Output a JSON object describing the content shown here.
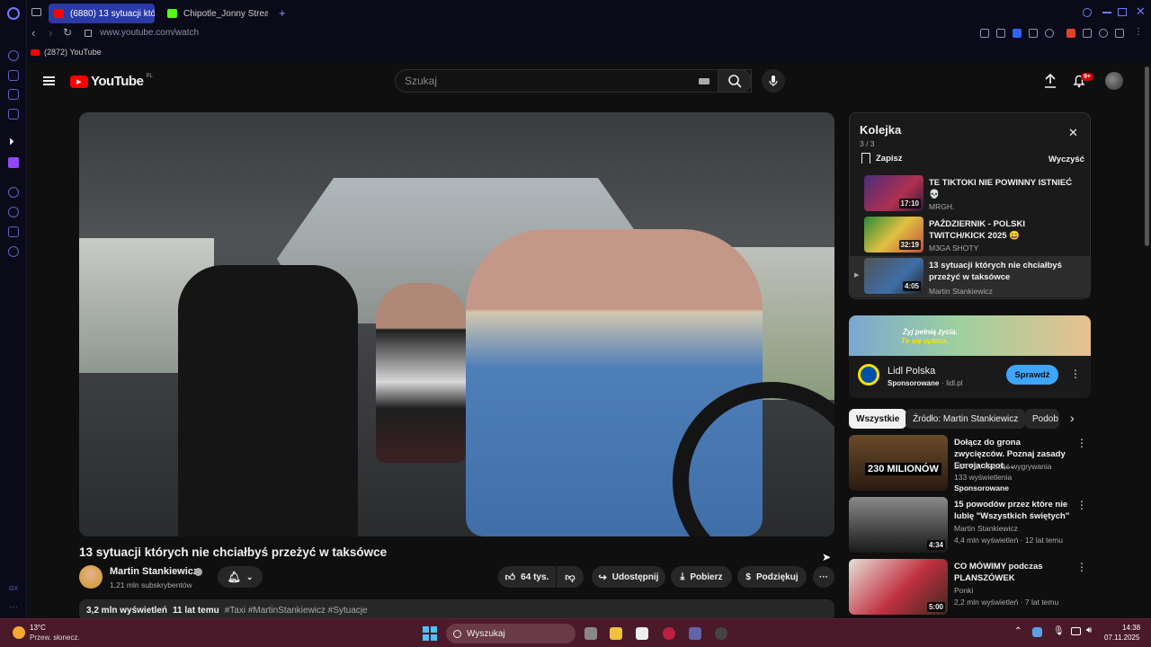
{
  "browser": {
    "tabs": [
      {
        "label": "(6880) 13 sytuacji których",
        "active": true
      },
      {
        "label": "Chipotle_Jonny Stream -",
        "active": false
      }
    ],
    "url": "www.youtube.com/watch",
    "bookmark": "(2872) YouTube",
    "gx_label": "GX"
  },
  "youtube": {
    "logo": "YouTube",
    "logo_region": "PL",
    "search_placeholder": "Szukaj",
    "notif_badge": "9+"
  },
  "video": {
    "title": "13 sytuacji których nie chciałbyś przeżyć w taksówce",
    "channel": "Martin Stankiewicz",
    "subscribers": "1,21 mln subskrybentów",
    "likes": "64 tys.",
    "share": "Udostępnij",
    "download": "Pobierz",
    "thanks": "Podziękuj",
    "views": "3,2 mln wyświetleń",
    "age": "11 lat temu",
    "tags": "#Taxi #MartinStankiewicz #Sytuacje"
  },
  "queue": {
    "title": "Kolejka",
    "count": "3 / 3",
    "save": "Zapisz",
    "clear": "Wyczyść",
    "items": [
      {
        "title": "TE TIKTOKI NIE POWINNY ISTNIEĆ 💀",
        "channel": "MRGH.",
        "duration": "17:10"
      },
      {
        "title": "PAŹDZIERNIK - POLSKI TWITCH/KICK 2025 😄",
        "channel": "M3GA SHOTY",
        "duration": "32:19"
      },
      {
        "title": "13 sytuacji których nie chciałbyś przeżyć w taksówce",
        "channel": "Martin Stankiewicz",
        "duration": "4:05"
      }
    ]
  },
  "ad": {
    "banner_line1": "Żyj pełnią życia.",
    "banner_line2": "To się opłaca.",
    "brand": "Lidl Polska",
    "sponsored": "Sponsorowane",
    "domain": "· lidl.pl",
    "cta": "Sprawdź"
  },
  "chips": [
    "Wszystkie",
    "Źródło: Martin Stankiewicz",
    "Podob"
  ],
  "recommendations": [
    {
      "title": "Dołącz do grona zwycięzców. Poznaj zasady Eurojackpot,...",
      "line1": "LOTTO. Radość wygrywania",
      "line2": "133 wyświetlenia",
      "line3": "Sponsorowane",
      "thumb_text": "230 MILIONÓW",
      "duration": ""
    },
    {
      "title": "15 powodów przez które nie lubię \"Wszystkich świętych\"",
      "line1": "Martin Stankiewicz",
      "line2": "4,4 mln wyświetleń · 12 lat temu",
      "line3": "",
      "thumb_text": "",
      "duration": "4:34"
    },
    {
      "title": "CO MÓWIMY podczas PLANSZÓWEK",
      "line1": "Ponki",
      "line2": "2,2 mln wyświetleń · 7 lat temu",
      "line3": "",
      "thumb_text": "",
      "duration": "5:00"
    }
  ],
  "taskbar": {
    "temperature": "13°C",
    "weather": "Przew. słonecz.",
    "search": "Wyszukaj",
    "time": "14:38",
    "date": "07.11.2025"
  }
}
